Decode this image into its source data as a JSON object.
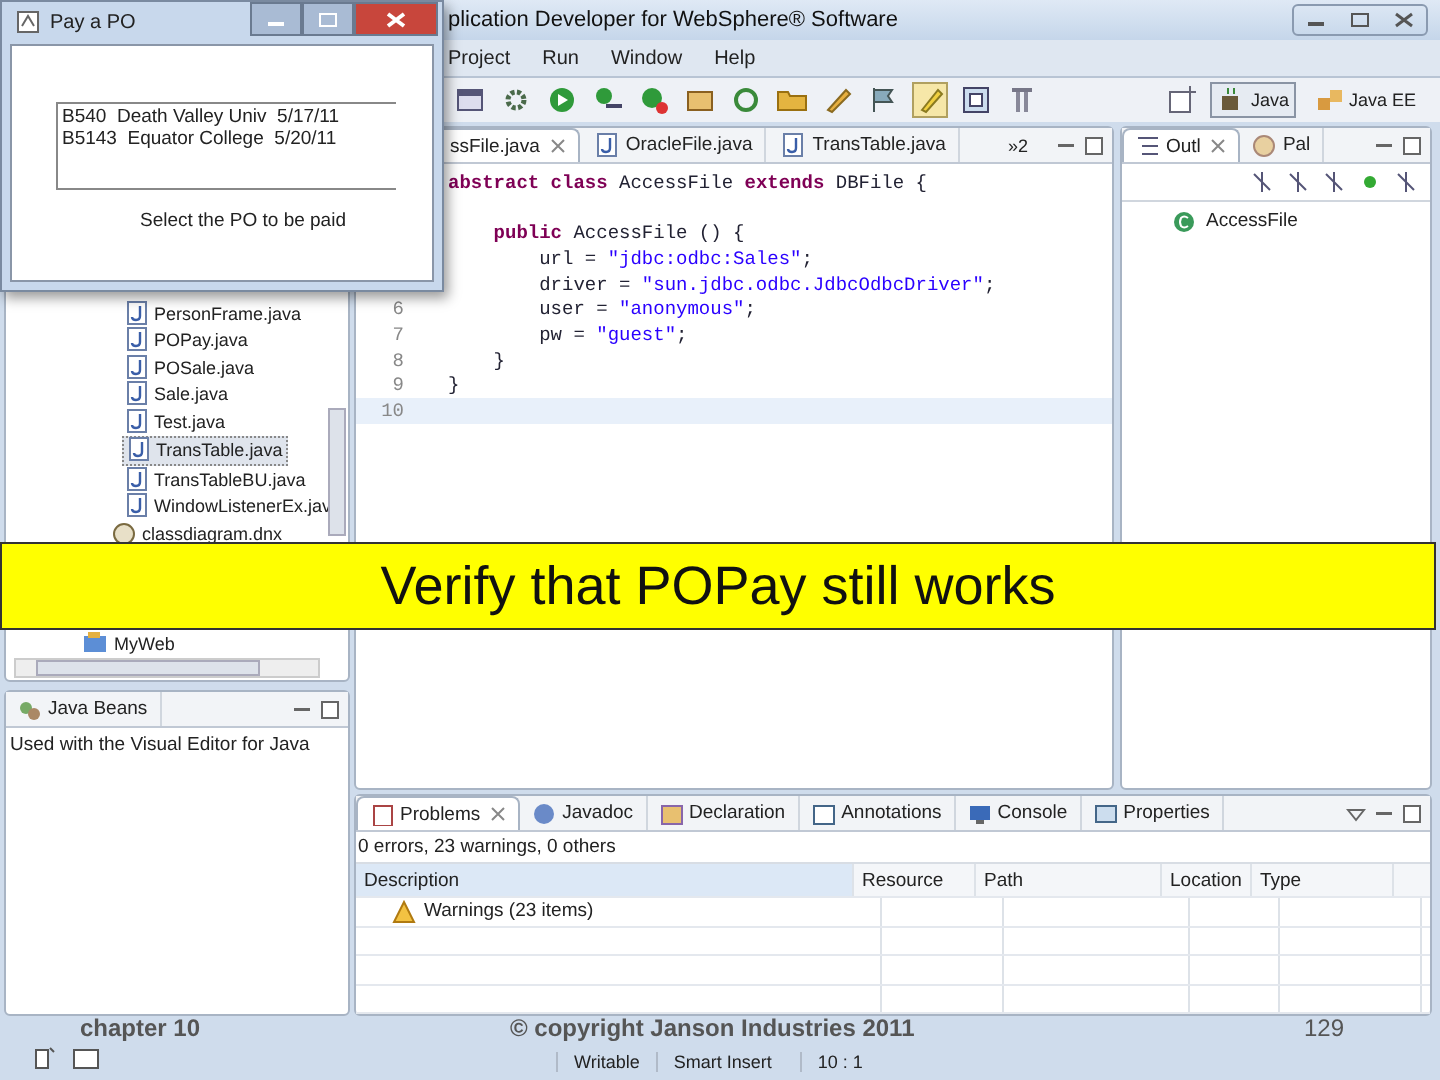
{
  "window": {
    "title": "plication Developer for WebSphere® Software"
  },
  "menu": [
    "Project",
    "Run",
    "Window",
    "Help"
  ],
  "perspectives": [
    {
      "label": "Java",
      "selected": true
    },
    {
      "label": "Java EE",
      "selected": false
    }
  ],
  "package_explorer": {
    "items": [
      {
        "label": "PersonFrame.java",
        "kind": "java",
        "selected": false
      },
      {
        "label": "POPay.java",
        "kind": "java",
        "selected": false
      },
      {
        "label": "POSale.java",
        "kind": "java",
        "selected": false
      },
      {
        "label": "Sale.java",
        "kind": "java",
        "selected": false
      },
      {
        "label": "Test.java",
        "kind": "java",
        "selected": false
      },
      {
        "label": "TransTable.java",
        "kind": "java",
        "selected": true
      },
      {
        "label": "TransTableBU.java",
        "kind": "java",
        "selected": false
      },
      {
        "label": "WindowListenerEx.jav",
        "kind": "java",
        "selected": false
      },
      {
        "label": "classdiagram.dnx",
        "kind": "diagram",
        "selected": false
      }
    ],
    "bottom_items": [
      {
        "label": "MyWeb",
        "kind": "project",
        "selected": false
      }
    ]
  },
  "java_beans": {
    "tab": "Java Beans",
    "text": "Used with the Visual Editor for Java"
  },
  "editor": {
    "tabs": [
      {
        "label": "ssFile.java",
        "selected": true
      },
      {
        "label": "OracleFile.java",
        "selected": false
      },
      {
        "label": "TransTable.java",
        "selected": false
      }
    ],
    "overflow": "»2",
    "lines": [
      {
        "kind": "code",
        "tokens": [
          {
            "kind": "kw",
            "text": "abstract class"
          },
          {
            "kind": "plain",
            "text": " AccessFile "
          },
          {
            "kind": "kw",
            "text": "extends"
          },
          {
            "kind": "plain",
            "text": " DBFile {"
          }
        ]
      },
      {
        "kind": "blank"
      },
      {
        "kind": "code",
        "tokens": [
          {
            "kind": "kw",
            "text": "    public"
          },
          {
            "kind": "plain",
            "text": " AccessFile () {"
          }
        ]
      },
      {
        "kind": "code",
        "tokens": [
          {
            "kind": "plain",
            "text": "        url = "
          },
          {
            "kind": "str",
            "text": "\"jdbc:odbc:Sales\""
          },
          {
            "kind": "plain",
            "text": ";"
          }
        ]
      },
      {
        "kind": "code",
        "tokens": [
          {
            "kind": "plain",
            "text": "        driver = "
          },
          {
            "kind": "str",
            "text": "\"sun.jdbc.odbc.JdbcOdbcDriver\""
          },
          {
            "kind": "plain",
            "text": ";"
          }
        ]
      },
      {
        "kind": "code",
        "number": "6",
        "tokens": [
          {
            "kind": "plain",
            "text": "        user = "
          },
          {
            "kind": "str",
            "text": "\"anonymous\""
          },
          {
            "kind": "plain",
            "text": ";"
          }
        ]
      },
      {
        "kind": "code",
        "number": "7",
        "tokens": [
          {
            "kind": "plain",
            "text": "        pw = "
          },
          {
            "kind": "str",
            "text": "\"guest\""
          },
          {
            "kind": "plain",
            "text": ";"
          }
        ]
      },
      {
        "kind": "code",
        "number": "8",
        "tokens": [
          {
            "kind": "plain",
            "text": "    }"
          }
        ]
      },
      {
        "kind": "code",
        "number": "9",
        "tokens": [
          {
            "kind": "plain",
            "text": "}"
          }
        ]
      },
      {
        "kind": "blank",
        "number": "10",
        "current": true
      }
    ]
  },
  "outline": {
    "tabs": [
      {
        "label": "Outl",
        "selected": true
      },
      {
        "label": "Pal",
        "selected": false
      }
    ],
    "items": [
      "AccessFile"
    ]
  },
  "problems": {
    "tabs": [
      {
        "label": "Problems",
        "selected": true
      },
      {
        "label": "Javadoc",
        "selected": false
      },
      {
        "label": "Declaration",
        "selected": false
      },
      {
        "label": "Annotations",
        "selected": false
      },
      {
        "label": "Console",
        "selected": false
      },
      {
        "label": "Properties",
        "selected": false
      }
    ],
    "summary": "0 errors, 23 warnings, 0 others",
    "columns": [
      "Description",
      "Resource",
      "Path",
      "Location",
      "Type"
    ],
    "rows": [
      {
        "description": "Warnings (23 items)",
        "kind": "warning"
      }
    ]
  },
  "status_bar": [
    "Writable",
    "Smart Insert",
    "10 : 1"
  ],
  "dialog": {
    "title": "Pay a PO",
    "list_items": [
      "B540  Death Valley Univ  5/17/11",
      "B5143  Equator College  5/20/11"
    ],
    "label": "Select the PO to be paid"
  },
  "slide": {
    "banner": "Verify that POPay still works",
    "footer_left": "chapter 10",
    "footer_center": "© copyright Janson Industries 2011",
    "page_number": "129"
  }
}
